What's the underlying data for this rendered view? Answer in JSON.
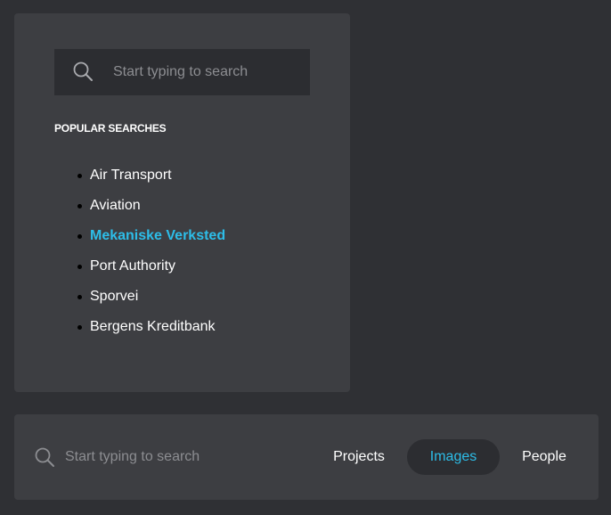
{
  "dropdown": {
    "search": {
      "icon": "search-icon",
      "placeholder": "Start typing to search"
    },
    "popular_heading": "POPULAR SEARCHES",
    "popular_items": [
      {
        "label": "Air Transport"
      },
      {
        "label": "Aviation"
      },
      {
        "label": "Mekaniske Verksted",
        "active": true
      },
      {
        "label": "Port Authority"
      },
      {
        "label": "Sporvei"
      },
      {
        "label": "Bergens Kreditbank"
      }
    ]
  },
  "search_bar": {
    "icon": "search-icon",
    "placeholder": "Start typing to search",
    "tabs": [
      {
        "label": "Projects"
      },
      {
        "label": "Images",
        "selected": true
      },
      {
        "label": "People"
      }
    ]
  },
  "colors": {
    "background": "#2f3034",
    "panel": "#3d3e42",
    "input_background": "#2c2d31",
    "accent": "#2dbde8",
    "placeholder": "#8c8d91"
  }
}
